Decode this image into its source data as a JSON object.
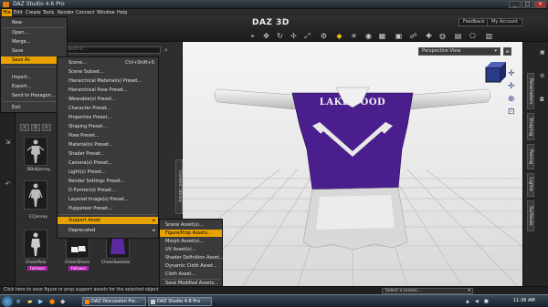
{
  "window": {
    "title": "DAZ Studio 4.6 Pro",
    "minimize": "_",
    "maximize": "□",
    "close": "✕"
  },
  "menubar": {
    "items": [
      "File",
      "Edit",
      "Create",
      "Tools",
      "Render",
      "Connect",
      "Window",
      "Help"
    ]
  },
  "header": {
    "logo": "DAZ 3D",
    "feedback": "Feedback",
    "my_account": "My Account"
  },
  "left_panel": {
    "search_placeholder": "Search in ...",
    "items": [
      {
        "label": "BBallJersey"
      },
      {
        "label": "CCJersey"
      },
      {
        "label": "CheerPolo"
      },
      {
        "label": "CheerShoes"
      },
      {
        "label": "CheerSweater"
      }
    ],
    "badges": [
      "Follower",
      "Follower"
    ]
  },
  "file_menu": {
    "items": [
      {
        "label": "New"
      },
      {
        "label": "Open..."
      },
      {
        "label": "Merge..."
      },
      {
        "label": "Save"
      },
      {
        "label": "Save As"
      },
      {
        "label": "Import..."
      },
      {
        "label": "Export..."
      },
      {
        "label": "Send to Hexagon..."
      },
      {
        "label": "Exit"
      }
    ]
  },
  "saveas_menu": {
    "items": [
      {
        "label": "Scene...",
        "shortcut": "Ctrl+Shift+S"
      },
      {
        "label": "Scene Subset..."
      },
      {
        "label": "Hierarchical Material(s) Preset..."
      },
      {
        "label": "Hierarchical Pose Preset..."
      },
      {
        "label": "Wearable(s) Preset..."
      },
      {
        "label": "Character Preset..."
      },
      {
        "label": "Properties Preset..."
      },
      {
        "label": "Shaping Preset..."
      },
      {
        "label": "Pose Preset..."
      },
      {
        "label": "Material(s) Preset..."
      },
      {
        "label": "Shader Preset..."
      },
      {
        "label": "Camera(s) Preset..."
      },
      {
        "label": "Light(s) Preset..."
      },
      {
        "label": "Render Settings Preset..."
      },
      {
        "label": "D-Former(s) Preset..."
      },
      {
        "label": "Layered Image(s) Preset..."
      },
      {
        "label": "Puppeteer Preset..."
      },
      {
        "label": "Support Asset"
      },
      {
        "label": "Deprecated"
      }
    ]
  },
  "support_menu": {
    "items": [
      {
        "label": "Scene Asset(s)..."
      },
      {
        "label": "Figure/Prop Assets..."
      },
      {
        "label": "Morph Asset(s)..."
      },
      {
        "label": "UV Asset(s)..."
      },
      {
        "label": "Shader Definition Asset..."
      },
      {
        "label": "Dynamic Cloth Asset..."
      },
      {
        "label": "Cloth Asset..."
      },
      {
        "label": "Save Modified Assets..."
      }
    ]
  },
  "viewport": {
    "camera": "Perspective View",
    "jersey_text": "LAKEWOOD"
  },
  "right_tabs": [
    "Parameters",
    "Shaping",
    "Posing",
    "Lights",
    "Surfaces"
  ],
  "left_vtab": "Content Library",
  "statusbar": {
    "text": "Click here to save figure or prop support assets for the selected object",
    "lesson": "Select a Lesson..."
  },
  "taskbar": {
    "items": [
      "DAZ Discussion For...",
      "DAZ Studio 4.6 Pro"
    ],
    "time": "11:36 AM"
  },
  "colors": {
    "highlight": "#e8a200",
    "jersey_purple": "#4a1e8c",
    "badge": "#b020b0"
  }
}
